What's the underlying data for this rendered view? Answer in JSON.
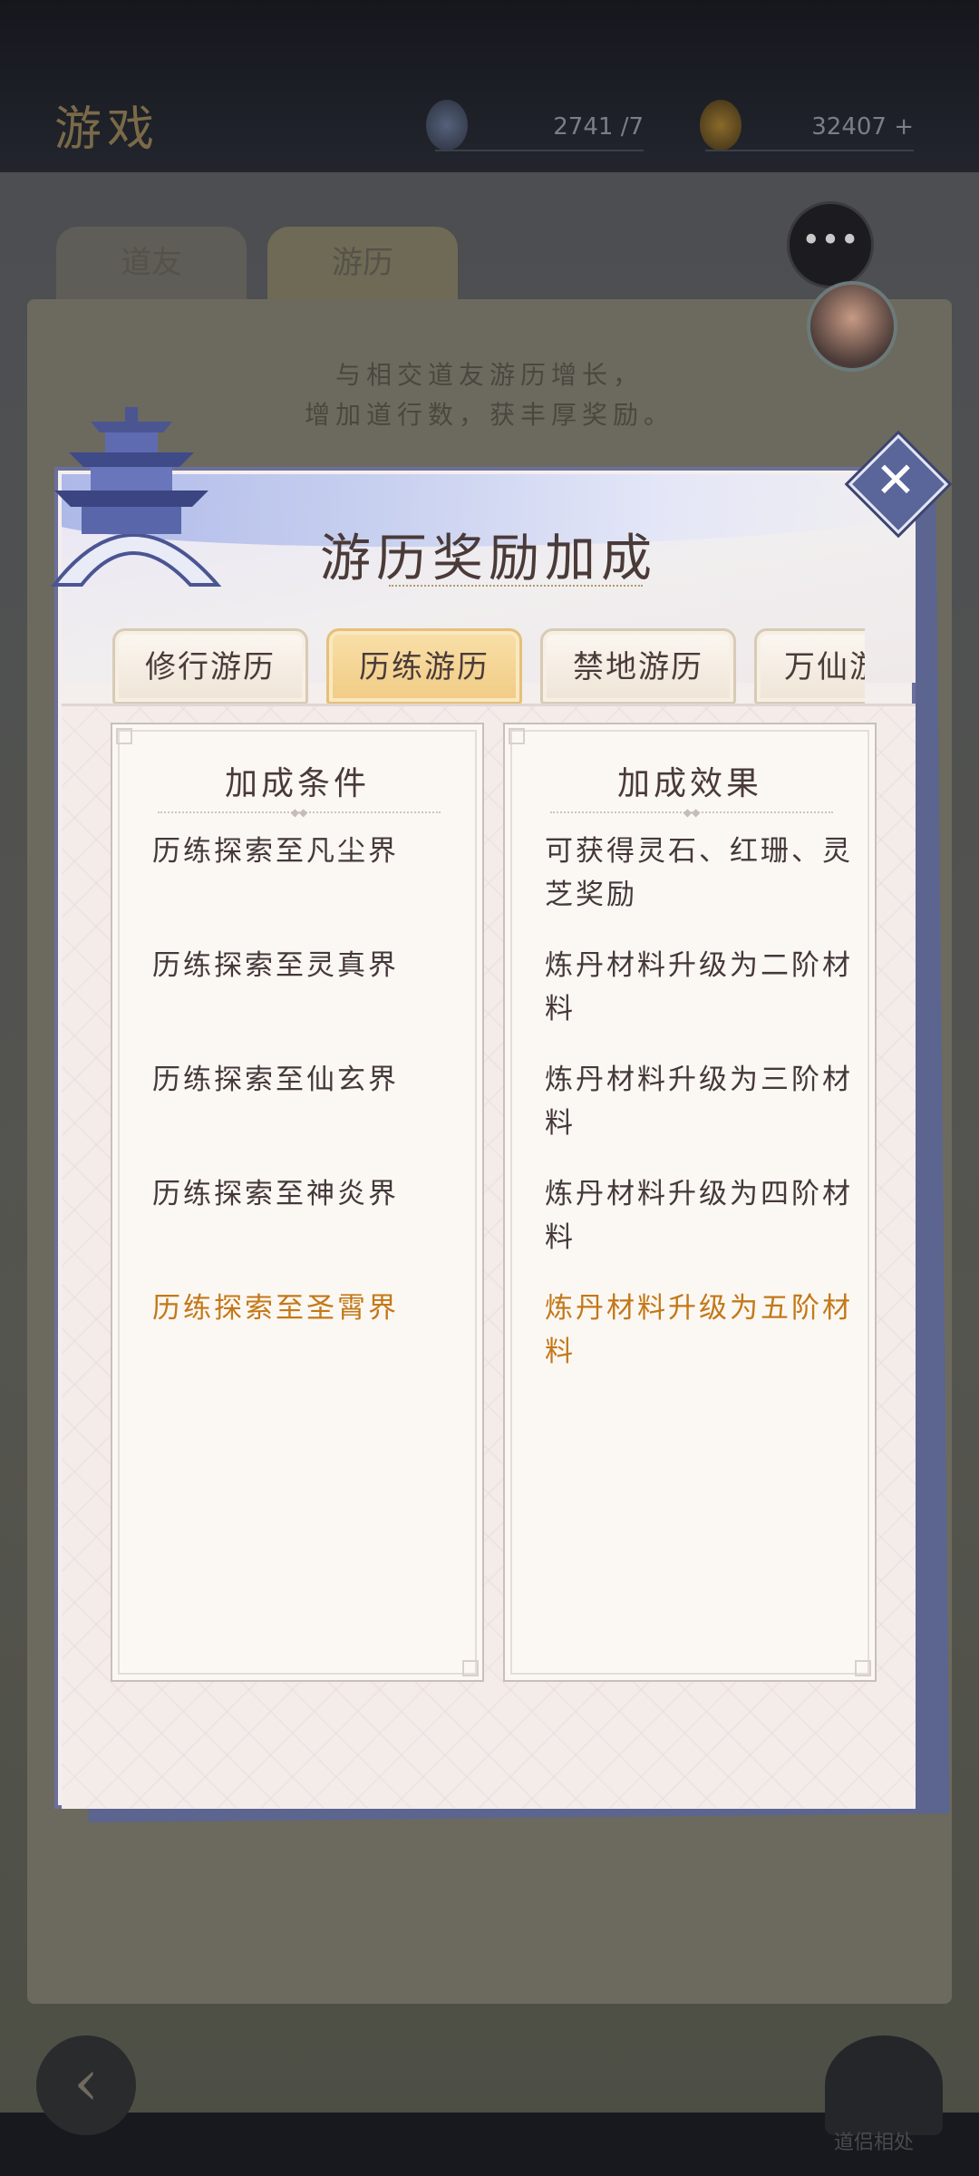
{
  "background": {
    "page_title": "游戏",
    "resource_1": "2741 /7",
    "resource_2": "32407 +",
    "tabs": [
      "道友",
      "游历"
    ],
    "intro_line_1": "与相交道友游历增长，",
    "intro_line_2": "增加道行数，获丰厚奖励。",
    "corner_label": "道侣相处"
  },
  "modal": {
    "title": "游历奖励加成",
    "close_label": "✕",
    "tabs": [
      {
        "label": "修行游历",
        "active": false
      },
      {
        "label": "历练游历",
        "active": true
      },
      {
        "label": "禁地游历",
        "active": false
      },
      {
        "label": "万仙游历",
        "active": false
      }
    ],
    "condition_header": "加成条件",
    "effect_header": "加成效果",
    "rows": [
      {
        "condition": "历练探索至凡尘界",
        "effect": "可获得灵石、红珊、灵芝奖励",
        "highlight": false
      },
      {
        "condition": "历练探索至灵真界",
        "effect": "炼丹材料升级为二阶材料",
        "highlight": false
      },
      {
        "condition": "历练探索至仙玄界",
        "effect": "炼丹材料升级为三阶材料",
        "highlight": false
      },
      {
        "condition": "历练探索至神炎界",
        "effect": "炼丹材料升级为四阶材料",
        "highlight": false
      },
      {
        "condition": "历练探索至圣霄界",
        "effect": "炼丹材料升级为五阶材料",
        "highlight": true
      }
    ]
  },
  "colors": {
    "highlight": "#c47817",
    "text": "#45383a",
    "active_tab": "#f1cc85",
    "frame": "#6b6f9b"
  }
}
